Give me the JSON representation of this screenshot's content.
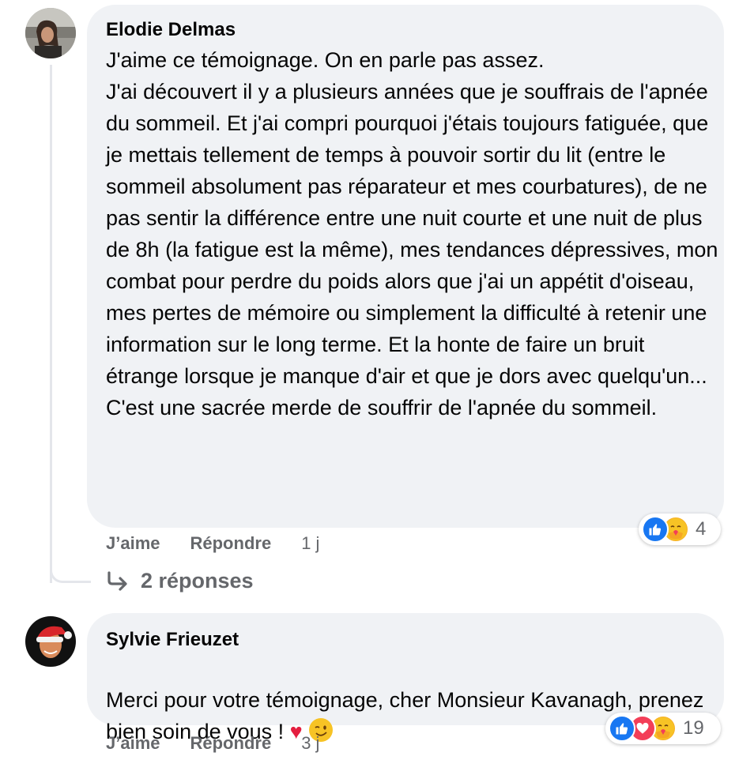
{
  "comments": [
    {
      "author": "Elodie Delmas",
      "text": "J'aime ce témoignage. On en parle pas assez.\nJ'ai découvert il y a plusieurs années que je souffrais de l'apnée du sommeil. Et j'ai compri pourquoi j'étais toujours fatiguée, que je mettais tellement de temps à pouvoir sortir du lit (entre le sommeil absolument pas réparateur et mes courbatures), de ne pas sentir la différence entre une nuit courte et une nuit de plus de 8h (la fatigue est la même), mes tendances dépressives, mon combat pour perdre du poids alors que j'ai un appétit d'oiseau, mes pertes de mémoire ou simplement la difficulté à retenir une information sur le long terme. Et la honte de faire un bruit étrange lorsque je manque d'air et que je dors avec quelqu'un...\nC'est une sacrée merde de souffrir de l'apnée du sommeil.",
      "like_label": "J’aime",
      "reply_label": "Répondre",
      "time": "1 j",
      "reactions": [
        "like-icon",
        "care-icon"
      ],
      "reaction_count": "4",
      "replies_label": "2 réponses"
    },
    {
      "author": "Sylvie Frieuzet",
      "text": "Merci pour votre témoignage, cher Monsieur Kavanagh, prenez bien soin de vous ! ",
      "like_label": "J’aime",
      "reply_label": "Répondre",
      "time": "3 j",
      "reactions": [
        "like-icon",
        "love-icon",
        "care-icon"
      ],
      "reaction_count": "19"
    }
  ],
  "colors": {
    "bubble": "#f0f2f5",
    "secondary_text": "#65676b",
    "like_blue": "#1877f2",
    "love_red": "#f33e58",
    "care_yellow": "#f7b125"
  }
}
